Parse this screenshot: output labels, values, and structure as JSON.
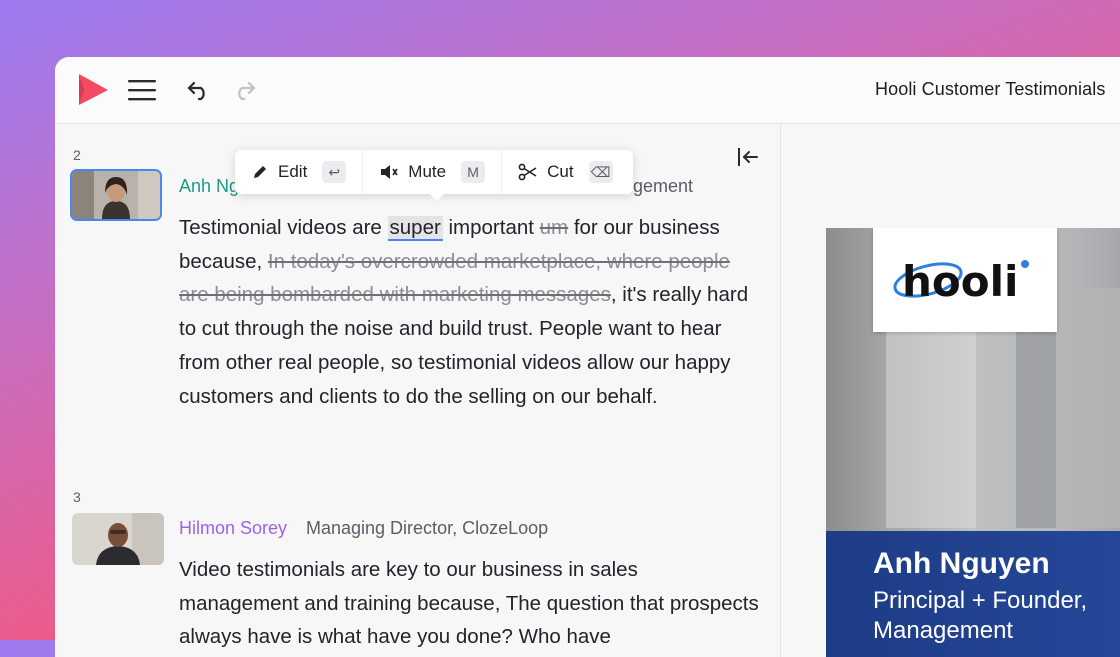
{
  "header": {
    "title": "Hooli Customer Testimonials"
  },
  "toolbar": {
    "edit_label": "Edit",
    "edit_key": "↩",
    "mute_label": "Mute",
    "mute_key": "M",
    "cut_label": "Cut",
    "cut_key": "⌫"
  },
  "segments": [
    {
      "number": "2",
      "speaker": "Anh Ng",
      "role": "gement",
      "transcript": {
        "p1": "Testimonial videos are ",
        "highlight": "super",
        "p2": " important ",
        "s1": "um",
        "p3": " for our business because, ",
        "s2": "In today's overcrowded marketplace, where people are being bombarded with marketing messages",
        "p4": ", it's really hard to cut through the noise and build trust. People want to hear from other real people, so testimonial videos allow our happy customers and clients to do the selling on our behalf."
      }
    },
    {
      "number": "3",
      "speaker": "Hilmon Sorey",
      "role": "Managing Director, ClozeLoop",
      "transcript": "Video testimonials are key to our business in sales management and training because, The question that prospects always have is what have you done? Who have"
    }
  ],
  "preview": {
    "logo_text": "hooli",
    "lower_third_name": "Anh Nguyen",
    "lower_third_title_line1": "Principal + Founder,",
    "lower_third_title_line2": "Management"
  },
  "colors": {
    "accent_blue": "#4a86f0",
    "speaker2_color": "#1f9a86",
    "speaker3_color": "#a260e8",
    "logo_red": "#f44a62",
    "lower_third_blue": "#1e3c86"
  }
}
